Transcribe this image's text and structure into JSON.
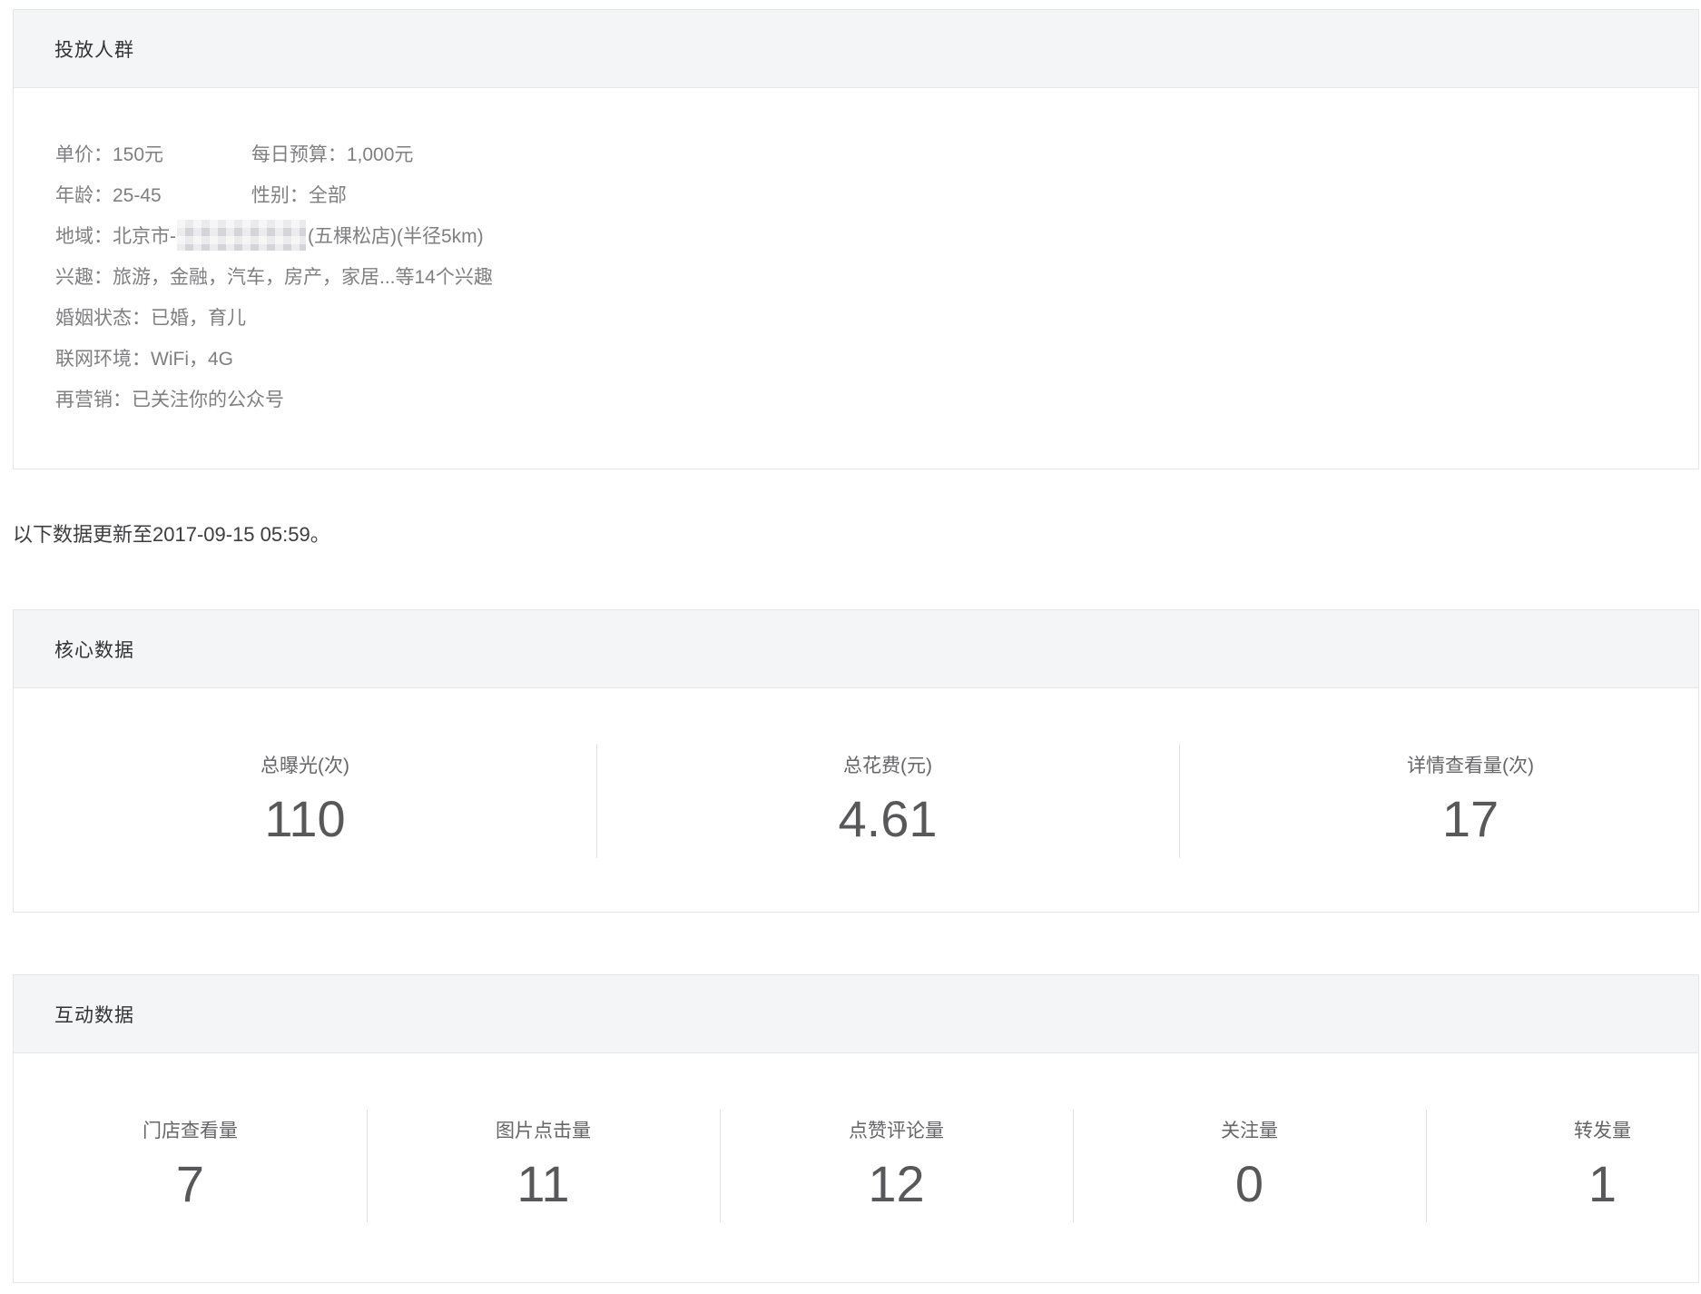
{
  "audience_panel": {
    "title": "投放人群",
    "rows": [
      {
        "left": "单价：150元",
        "right": "每日预算：1,000元"
      },
      {
        "left": "年龄：25-45",
        "right": "性别：全部"
      },
      {
        "prefix": "地域：北京市-",
        "masked": "censored-location",
        "suffix": "(五棵松店)(半径5km)"
      },
      {
        "text": "兴趣：旅游，金融，汽车，房产，家居...等14个兴趣"
      },
      {
        "text": "婚姻状态：已婚，育儿"
      },
      {
        "text": "联网环境：WiFi，4G"
      },
      {
        "text": "再营销：已关注你的公众号"
      }
    ]
  },
  "update_notice": "以下数据更新至2017-09-15 05:59。",
  "core_panel": {
    "title": "核心数据",
    "metrics": [
      {
        "label": "总曝光(次)",
        "value": "110"
      },
      {
        "label": "总花费(元)",
        "value": "4.61"
      },
      {
        "label": "详情查看量(次)",
        "value": "17"
      }
    ]
  },
  "interaction_panel": {
    "title": "互动数据",
    "metrics": [
      {
        "label": "门店查看量",
        "value": "7"
      },
      {
        "label": "图片点击量",
        "value": "11"
      },
      {
        "label": "点赞评论量",
        "value": "12"
      },
      {
        "label": "关注量",
        "value": "0"
      },
      {
        "label": "转发量",
        "value": "1"
      }
    ]
  },
  "colors": {
    "panel_header_bg": "#f4f5f7",
    "panel_border": "#e5e6ea",
    "header_text": "#333333",
    "body_text": "#7f7f81",
    "metric_label": "#666668",
    "metric_value": "#58585a",
    "divider": "#e3e3e6"
  }
}
